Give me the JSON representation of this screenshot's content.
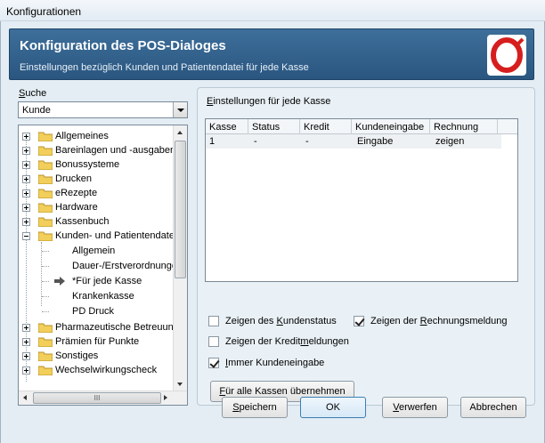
{
  "window": {
    "title": "Konfigurationen"
  },
  "header": {
    "title": "Konfiguration des POS-Dialoges",
    "subtitle": "Einstellungen bezüglich Kunden und Patientendatei für jede Kasse",
    "logo_icon": "red-ring-logo",
    "logo_color": "#d61e1e"
  },
  "search": {
    "label_pre": "S",
    "label_post": "uche",
    "value": "Kunde"
  },
  "tree": {
    "items": [
      {
        "label": "Allgemeines"
      },
      {
        "label": "Bareinlagen und -ausgaben"
      },
      {
        "label": "Bonussysteme"
      },
      {
        "label": "Drucken"
      },
      {
        "label": "eRezepte"
      },
      {
        "label": "Hardware"
      },
      {
        "label": "Kassenbuch"
      },
      {
        "label": "Kunden- und Patientendatei"
      },
      {
        "label": "Allgemein"
      },
      {
        "label": "Dauer-/Erstverordnungen"
      },
      {
        "label": "*Für jede Kasse"
      },
      {
        "label": "Krankenkasse"
      },
      {
        "label": "PD Druck"
      },
      {
        "label": "Pharmazeutische Betreuung"
      },
      {
        "label": "Prämien für Punkte"
      },
      {
        "label": "Sonstiges"
      },
      {
        "label": "Wechselwirkungscheck"
      }
    ],
    "hscroll_grip": "III"
  },
  "panel": {
    "title_u": "E",
    "title_rest": "instellungen für jede Kasse",
    "columns": [
      "Kasse",
      "Status",
      "Kredit",
      "Kundeneingabe",
      "Rechnung"
    ],
    "rows": [
      [
        "1",
        "-",
        "-",
        "Eingabe",
        "zeigen"
      ]
    ],
    "checks": {
      "kundenstatus": {
        "pre": "Zeigen des ",
        "u": "K",
        "post": "undenstatus",
        "checked": false
      },
      "rechnungsmeldung": {
        "pre": "Zeigen der ",
        "u": "R",
        "post": "echnungsmeldung",
        "checked": true
      },
      "kreditmeldungen": {
        "pre": "Zeigen der Kredit",
        "u": "m",
        "post": "eldungen",
        "checked": false
      },
      "kundeneingabe": {
        "pre": "",
        "u": "I",
        "post": "mmer Kundeneingabe",
        "checked": true
      }
    },
    "apply_all": {
      "u": "F",
      "post": "ür alle Kassen übernehmen"
    }
  },
  "buttons": {
    "save": {
      "u": "S",
      "post": "peichern"
    },
    "ok": "OK",
    "discard": {
      "u": "V",
      "post": "erwerfen"
    },
    "cancel": "Abbrechen"
  }
}
